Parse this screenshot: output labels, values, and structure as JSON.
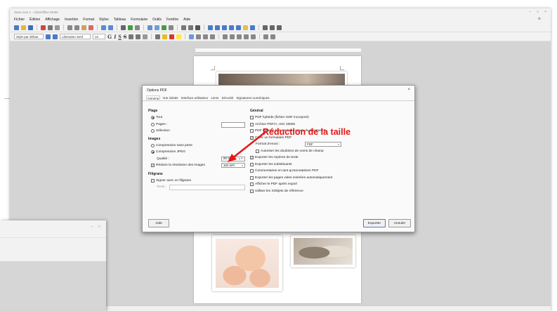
{
  "window": {
    "title": "Sans nom 1 - LibreOffice Writer",
    "controls": [
      "–",
      "□",
      "×"
    ]
  },
  "menu": {
    "items": [
      "Fichier",
      "Édition",
      "Affichage",
      "Insertion",
      "Format",
      "Styles",
      "Tableau",
      "Formulaire",
      "Outils",
      "Fenêtre",
      "Aide"
    ],
    "close_doc": "⊗"
  },
  "toolbar": {
    "para_style": "Style par défaut",
    "font_name": "Liberation Serif",
    "font_size": "12",
    "bold_label": "G",
    "italic_label": "I",
    "underline_label": "S",
    "strike_label": "S"
  },
  "dialog": {
    "title": "Options PDF",
    "close": "×",
    "tabs": [
      "Général",
      "Vue initiale",
      "Interface utilisateur",
      "Liens",
      "Sécurité",
      "Signatures numériques"
    ],
    "plage": {
      "title": "Plage",
      "tout": "Tout",
      "pages": "Pages :",
      "selection": "Sélection"
    },
    "images": {
      "title": "Images",
      "sans_perte": "Compression sans perte",
      "jpeg": "Compression JPEG",
      "qualite_label": "Qualité :",
      "qualite_value": "90 %",
      "reduire_label": "Réduire la résolution des images",
      "dpi_value": "300 DPI"
    },
    "filigrane": {
      "title": "Filigrane",
      "signer": "Signer avec un filigrane",
      "texte_label": "Texte :"
    },
    "general": {
      "title": "Général",
      "hybride": "PDF hybride (fichier ODF incorporé)",
      "archive": "Archive PDF/A, ISO 19005",
      "marque": "PDF marqué (ajouter la structure du document)",
      "formulaire": "Créer un formulaire PDF",
      "format_envoi_label": "Format d'envoi :",
      "format_envoi_value": "FDF",
      "doublons": "Autoriser les doublons de noms de champ",
      "reperes": "Exporter les repères de texte",
      "substituants": "Exporter les substituants",
      "commentaires": "Commentaires en tant qu'annotations PDF",
      "pages_vides": "Exporter les pages vides insérées automatiquement",
      "afficher": "Afficher le PDF après export",
      "xobjets": "Utiliser les XObjets de référence"
    },
    "buttons": {
      "aide": "Aide",
      "exporter": "Exporter",
      "annuler": "Annuler"
    }
  },
  "annotation": {
    "text": "Réduction de la taille",
    "color": "#e81515"
  }
}
